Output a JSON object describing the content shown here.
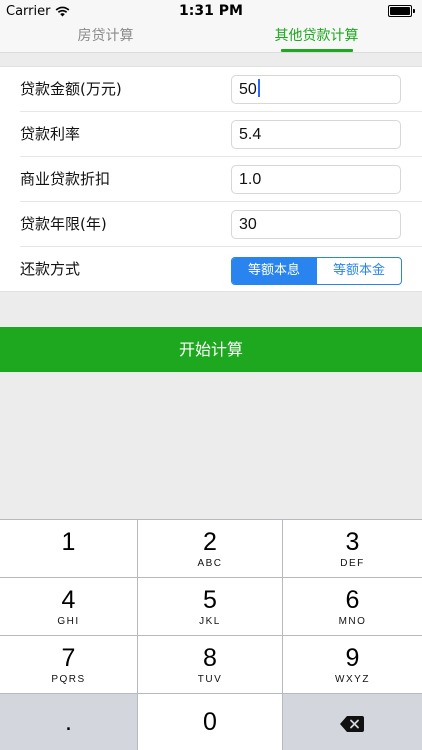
{
  "status_bar": {
    "carrier": "Carrier",
    "time": "1:31 PM"
  },
  "tabs": [
    {
      "label": "房贷计算",
      "active": false
    },
    {
      "label": "其他贷款计算",
      "active": true
    }
  ],
  "form": {
    "amount": {
      "label": "贷款金额(万元)",
      "value": "50"
    },
    "rate": {
      "label": "贷款利率",
      "value": "5.4"
    },
    "discount": {
      "label": "商业贷款折扣",
      "value": "1.0"
    },
    "years": {
      "label": "贷款年限(年)",
      "value": "30"
    },
    "method": {
      "label": "还款方式",
      "options": [
        "等额本息",
        "等额本金"
      ],
      "selected": "等额本息"
    }
  },
  "compute_button": "开始计算",
  "keypad": [
    {
      "num": "1",
      "letters": ""
    },
    {
      "num": "2",
      "letters": "ABC"
    },
    {
      "num": "3",
      "letters": "DEF"
    },
    {
      "num": "4",
      "letters": "GHI"
    },
    {
      "num": "5",
      "letters": "JKL"
    },
    {
      "num": "6",
      "letters": "MNO"
    },
    {
      "num": "7",
      "letters": "PQRS"
    },
    {
      "num": "8",
      "letters": "TUV"
    },
    {
      "num": "9",
      "letters": "WXYZ"
    },
    {
      "num": ".",
      "letters": ""
    },
    {
      "num": "0",
      "letters": ""
    }
  ],
  "colors": {
    "accent_green": "#1ea81f",
    "segment_blue": "#2a84f0",
    "caret_blue": "#2a66ff"
  }
}
